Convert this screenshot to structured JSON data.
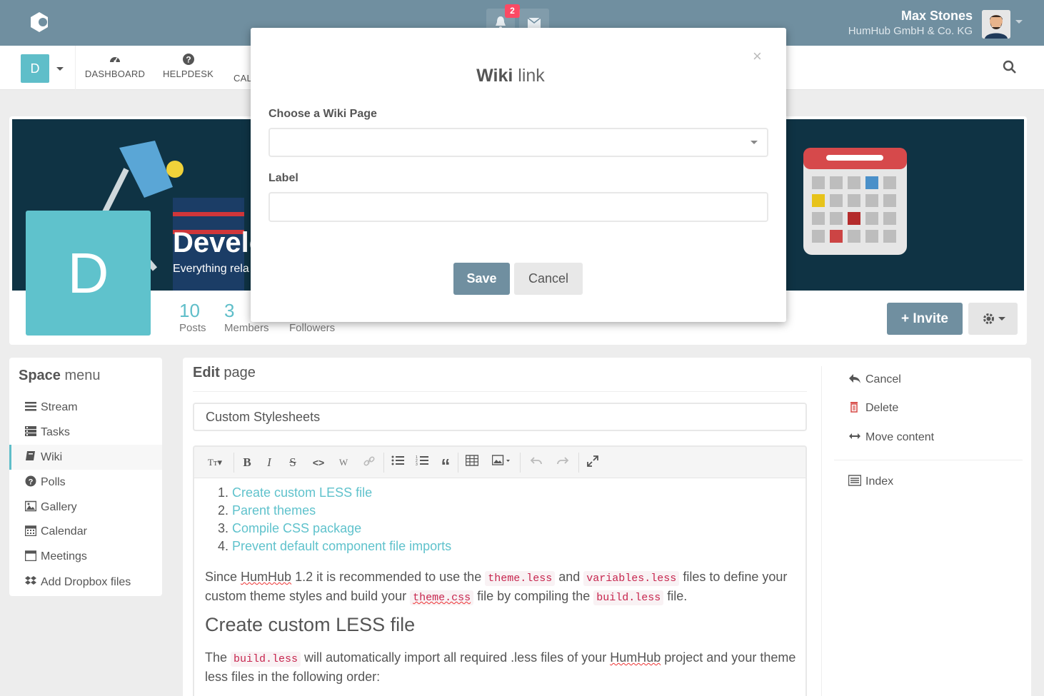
{
  "topbar": {
    "notification_count": "2",
    "user_name": "Max Stones",
    "user_company": "HumHub GmbH & Co. KG"
  },
  "nav": {
    "space_initial": "D",
    "items": [
      {
        "label": "DASHBOARD",
        "icon": "dashboard-icon"
      },
      {
        "label": "HELPDESK",
        "icon": "question-circle-icon"
      },
      {
        "label": "CAL",
        "icon": "calendar-icon"
      }
    ]
  },
  "space": {
    "initial": "D",
    "title": "Develo",
    "description": "Everything rela",
    "stats": [
      {
        "value": "10",
        "label": "Posts"
      },
      {
        "value": "3",
        "label": "Members"
      },
      {
        "value": "",
        "label": "Followers"
      }
    ],
    "invite_label": "Invite"
  },
  "menu": {
    "title_bold": "Space",
    "title_rest": "menu",
    "items": [
      {
        "label": "Stream",
        "icon": "bars-icon"
      },
      {
        "label": "Tasks",
        "icon": "tasks-icon"
      },
      {
        "label": "Wiki",
        "icon": "book-icon",
        "active": true
      },
      {
        "label": "Polls",
        "icon": "question-circle-icon"
      },
      {
        "label": "Gallery",
        "icon": "picture-icon"
      },
      {
        "label": "Calendar",
        "icon": "calendar-icon"
      },
      {
        "label": "Meetings",
        "icon": "calendar-blank-icon"
      },
      {
        "label": "Add Dropbox files",
        "icon": "dropbox-icon"
      }
    ]
  },
  "editor": {
    "title_bold": "Edit",
    "title_rest": "page",
    "page_title_value": "Custom Stylesheets",
    "toc": [
      "Create custom LESS file",
      "Parent themes",
      "Compile CSS package",
      "Prevent default component file imports"
    ],
    "para1": {
      "t1": "Since ",
      "humhub": "HumHub",
      "t2": " 1.2 it is recommended to use the ",
      "c1": "theme.less",
      "t3": " and ",
      "c2": "variables.less",
      "t4": " files to define your custom theme styles and build your ",
      "c3": "theme.css",
      "t5": " file by compiling the ",
      "c4": "build.less",
      "t6": " file."
    },
    "heading": "Create custom LESS file",
    "para2": {
      "t1": "The ",
      "c1": "build.less",
      "t2": " will automatically import all required .less files of your ",
      "humhub": "HumHub",
      "t3": " project and your theme less files in the following order:"
    }
  },
  "right_actions": {
    "cancel": "Cancel",
    "delete": "Delete",
    "move": "Move content",
    "index": "Index"
  },
  "modal": {
    "title_bold": "Wiki",
    "title_rest": "link",
    "close_glyph": "×",
    "choose_label": "Choose a Wiki Page",
    "selected_page": "",
    "label_label": "Label",
    "label_value": "",
    "save_label": "Save",
    "cancel_label": "Cancel"
  },
  "colors": {
    "topbar": "#708fa0",
    "accent": "#5fbec9",
    "badge": "#fc4a64",
    "primary_button": "#708fa0"
  }
}
